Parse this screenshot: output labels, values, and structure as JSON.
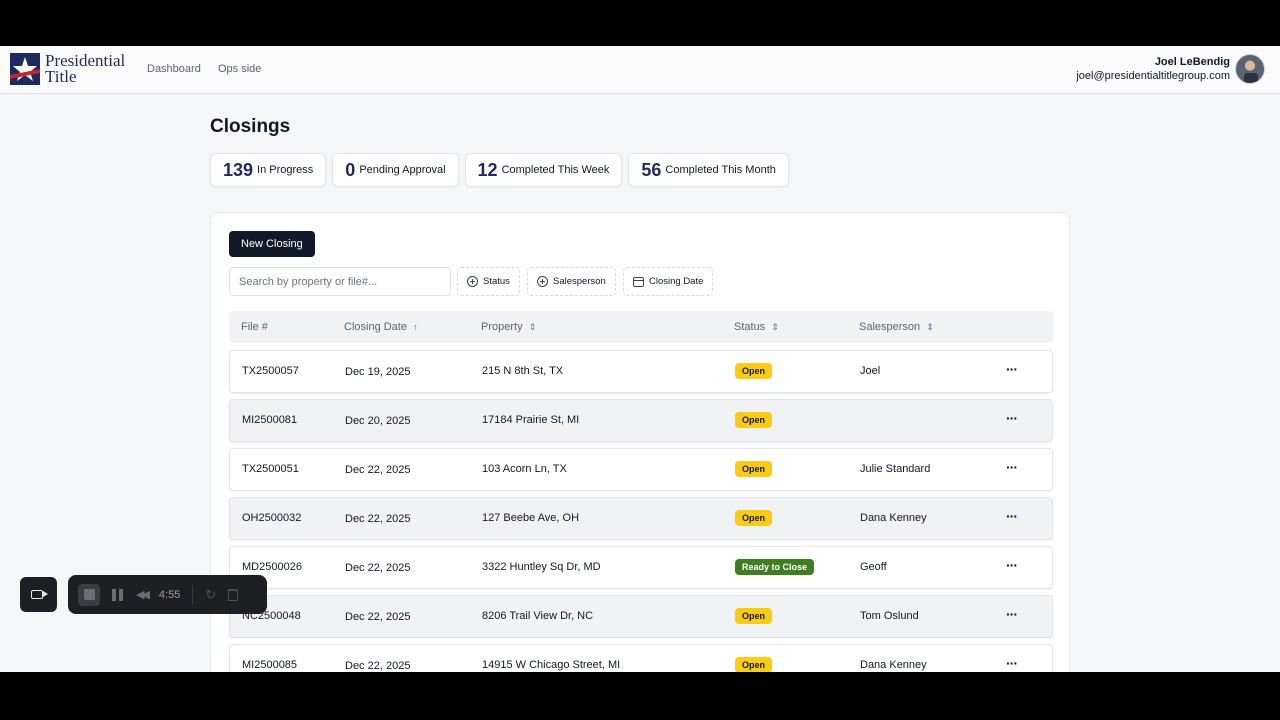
{
  "brand": {
    "line1": "Presidential",
    "line2": "Title"
  },
  "nav": {
    "dashboard": "Dashboard",
    "ops": "Ops side"
  },
  "user": {
    "name": "Joel LeBendig",
    "email": "joel@presidentialtitlegroup.com"
  },
  "page": {
    "title": "Closings"
  },
  "stats": [
    {
      "value": "139",
      "label": "In Progress"
    },
    {
      "value": "0",
      "label": "Pending Approval"
    },
    {
      "value": "12",
      "label": "Completed This Week"
    },
    {
      "value": "56",
      "label": "Completed This Month"
    }
  ],
  "toolbar": {
    "new_label": "New Closing",
    "search_placeholder": "Search by property or file#...",
    "filters": {
      "status": "Status",
      "salesperson": "Salesperson",
      "closing_date": "Closing Date"
    }
  },
  "table": {
    "headers": {
      "file": "File #",
      "date": "Closing Date",
      "property": "Property",
      "status": "Status",
      "salesperson": "Salesperson"
    },
    "sort_icons": {
      "date": "↑",
      "other": "⇕"
    },
    "more_label": "···",
    "rows": [
      {
        "file": "TX2500057",
        "date": "Dec 19, 2025",
        "property": "215 N 8th St, TX",
        "status": "Open",
        "salesperson": "Joel"
      },
      {
        "file": "MI2500081",
        "date": "Dec 20, 2025",
        "property": "17184 Prairie St, MI",
        "status": "Open",
        "salesperson": ""
      },
      {
        "file": "TX2500051",
        "date": "Dec 22, 2025",
        "property": "103 Acorn Ln, TX",
        "status": "Open",
        "salesperson": "Julie Standard"
      },
      {
        "file": "OH2500032",
        "date": "Dec 22, 2025",
        "property": "127 Beebe Ave, OH",
        "status": "Open",
        "salesperson": "Dana Kenney"
      },
      {
        "file": "MD2500026",
        "date": "Dec 22, 2025",
        "property": "3322 Huntley Sq Dr, MD",
        "status": "Ready to Close",
        "salesperson": "Geoff"
      },
      {
        "file": "NC2500048",
        "date": "Dec 22, 2025",
        "property": "8206 Trail View Dr, NC",
        "status": "Open",
        "salesperson": "Tom Oslund"
      },
      {
        "file": "MI2500085",
        "date": "Dec 22, 2025",
        "property": "14915 W Chicago Street, MI",
        "status": "Open",
        "salesperson": "Dana Kenney"
      }
    ]
  },
  "recorder": {
    "time": "4:55"
  },
  "colors": {
    "brand_navy": "#1f2b5c",
    "open_badge": "#facc15",
    "ready_badge": "#3f7d20",
    "primary_button": "#111827"
  }
}
